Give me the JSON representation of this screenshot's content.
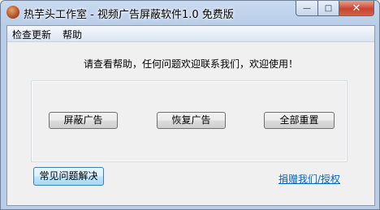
{
  "window": {
    "title": "热芋头工作室 - 视频广告屏蔽软件1.0 免费版",
    "app_icon": "taro-icon",
    "buttons": {
      "minimize": "—",
      "maximize": "□",
      "close": "✕"
    }
  },
  "menu": {
    "items": [
      {
        "label": "检查更新"
      },
      {
        "label": "帮助"
      }
    ]
  },
  "main": {
    "help_text": "请查看帮助，任何问题欢迎联系我们，欢迎使用！",
    "buttons": {
      "block_ads": "屏蔽广告",
      "restore_ads": "恢复广告",
      "reset_all": "全部重置"
    },
    "faq_button": "常见问题解决",
    "donate_link": "捐赠我们/授权"
  },
  "colors": {
    "link": "#0066cc",
    "titlebar": "#b9cde8",
    "close_button": "#c7452f"
  }
}
